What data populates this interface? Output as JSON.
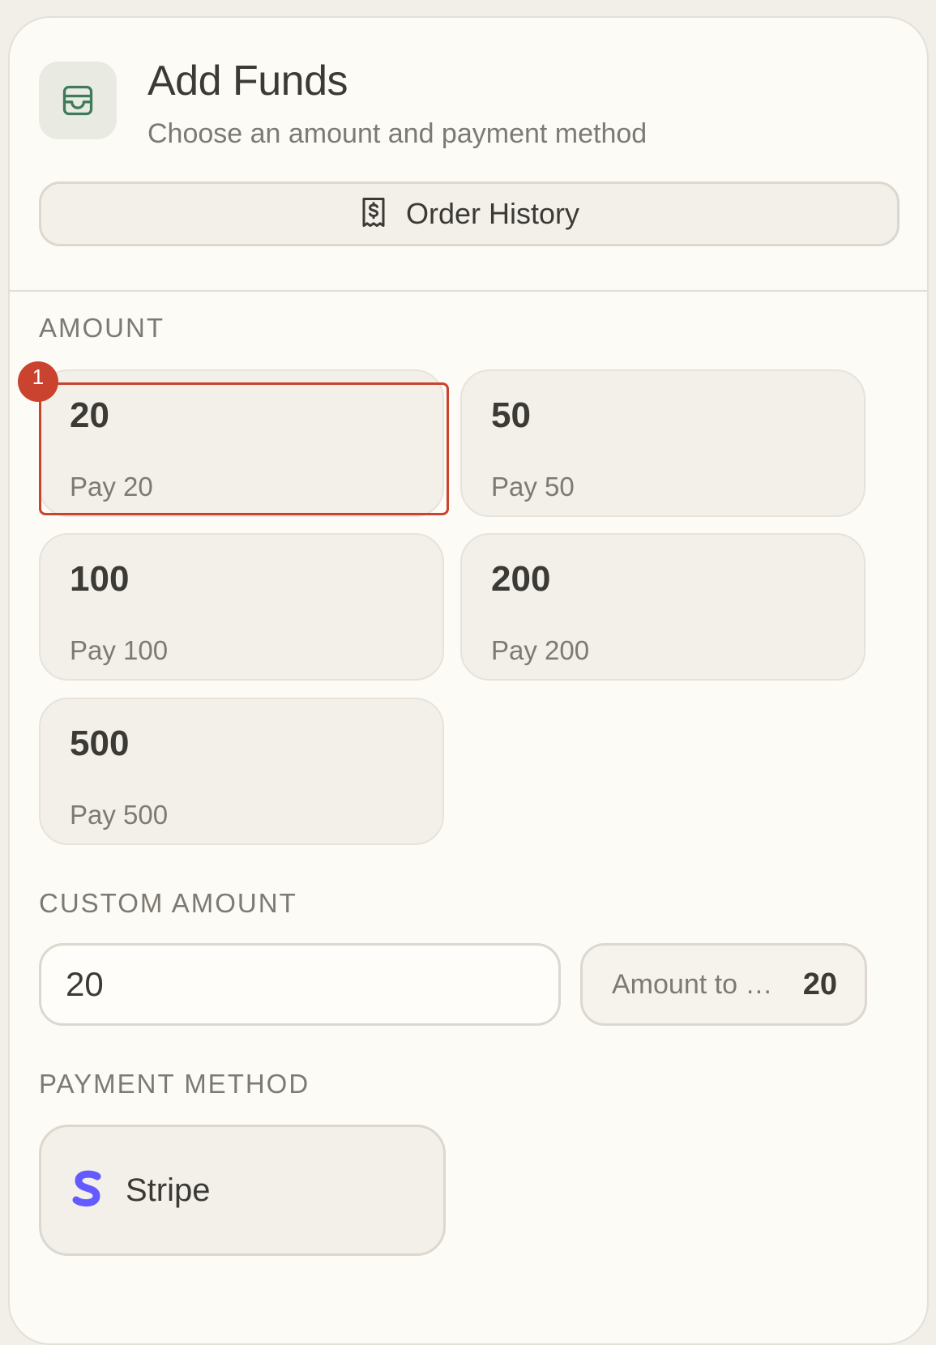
{
  "header": {
    "title": "Add Funds",
    "subtitle": "Choose an amount and payment method",
    "icon": "wallet-icon",
    "icon_color": "#3f7a5a"
  },
  "order_history": {
    "label": "Order History",
    "icon": "receipt-dollar-icon"
  },
  "amount_section": {
    "label": "AMOUNT",
    "options": [
      {
        "value": "20",
        "pay_label": "Pay 20"
      },
      {
        "value": "50",
        "pay_label": "Pay 50"
      },
      {
        "value": "100",
        "pay_label": "Pay 100"
      },
      {
        "value": "200",
        "pay_label": "Pay 200"
      },
      {
        "value": "500",
        "pay_label": "Pay 500"
      }
    ],
    "highlight_badge": "1",
    "highlight_color": "#c9432e"
  },
  "custom_section": {
    "label": "CUSTOM AMOUNT",
    "input_value": "20",
    "amount_to_label": "Amount to …",
    "amount_to_value": "20"
  },
  "payment_section": {
    "label": "PAYMENT METHOD",
    "methods": [
      {
        "name": "Stripe",
        "icon": "stripe-icon",
        "color": "#635bff"
      }
    ]
  }
}
